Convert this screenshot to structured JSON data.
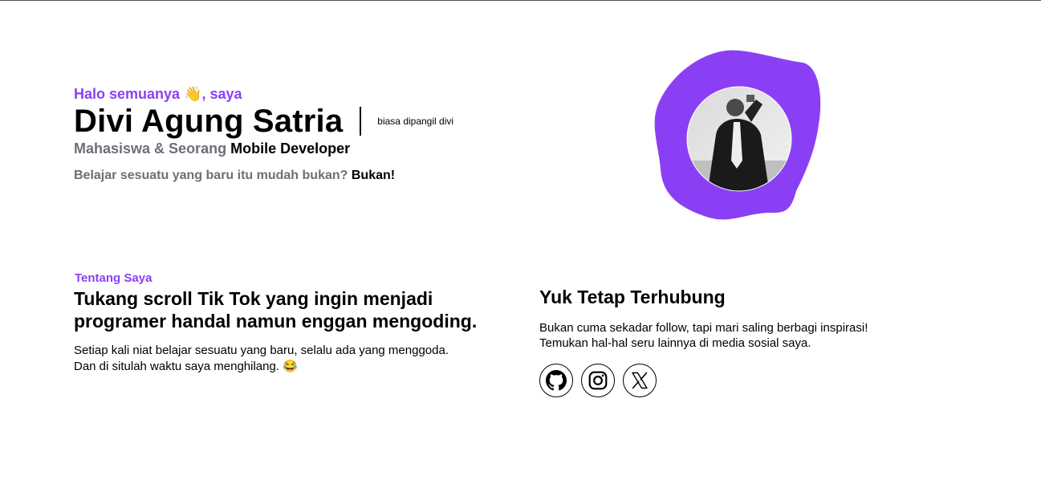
{
  "hero": {
    "greeting": "Halo semuanya 👋, saya",
    "name": "Divi Agung Satria",
    "nickname": "biasa dipangil divi",
    "role_prefix": "Mahasiswa & Seorang",
    "role_highlight": "Mobile Developer",
    "tagline_question": "Belajar sesuatu yang baru itu mudah bukan?",
    "tagline_answer": "Bukan!"
  },
  "about": {
    "label": "Tentang Saya",
    "title": "Tukang scroll Tik Tok yang ingin menjadi programer handal namun enggan mengoding.",
    "desc_line1": "Setiap kali niat belajar sesuatu yang baru, selalu ada yang menggoda.",
    "desc_line2": "Dan di situlah waktu saya menghilang. 😂"
  },
  "connect": {
    "title": "Yuk Tetap Terhubung",
    "desc_line1": "Bukan cuma sekadar follow, tapi mari saling berbagi inspirasi!",
    "desc_line2": "Temukan hal-hal seru lainnya di media sosial saya.",
    "socials": [
      {
        "icon": "github-icon"
      },
      {
        "icon": "instagram-icon"
      },
      {
        "icon": "x-icon"
      }
    ]
  },
  "colors": {
    "accent": "#8b3ff5",
    "muted": "#6b6f78"
  }
}
